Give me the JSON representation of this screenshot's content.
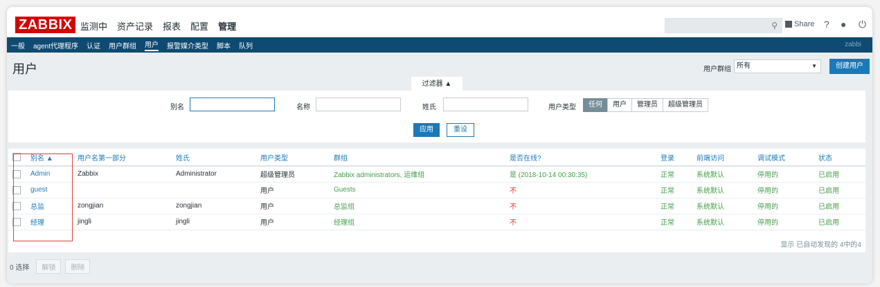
{
  "header": {
    "logo": "ZABBIX",
    "menu": [
      "监测中",
      "资产记录",
      "报表",
      "配置",
      "管理"
    ],
    "share": "Share",
    "help_icon": "?",
    "user_icon": "user",
    "power_icon": "power"
  },
  "subnav": {
    "items": [
      "一般",
      "agent代理程序",
      "认证",
      "用户群组",
      "用户",
      "报警媒介类型",
      "脚本",
      "队列"
    ],
    "right": "zabbi"
  },
  "page": {
    "title": "用户",
    "group_label": "用户群组",
    "group_value": "所有",
    "create_button": "创建用户"
  },
  "filter": {
    "tab": "过滤器 ▲",
    "alias_label": "别名",
    "alias_value": "",
    "name_label": "名称",
    "name_value": "",
    "surname_label": "姓氏",
    "surname_value": "",
    "type_label": "用户类型",
    "types": [
      "任何",
      "用户",
      "管理员",
      "超级管理员"
    ],
    "apply": "应用",
    "reset": "重设"
  },
  "table": {
    "headers": [
      "别名 ▲",
      "用户名第一部分",
      "姓氏",
      "用户类型",
      "群组",
      "是否在线?",
      "登录",
      "前端访问",
      "调试模式",
      "状态"
    ],
    "rows": [
      [
        "Admin",
        "Zabbix",
        "Administrator",
        "超级管理员",
        "Zabbix administrators, 运维组",
        "是 (2018-10-14 00:30:35)",
        "正常",
        "系统默认",
        "停用的",
        "已启用"
      ],
      [
        "guest",
        "",
        "",
        "用户",
        "Guests",
        "不",
        "正常",
        "系统默认",
        "停用的",
        "已启用"
      ],
      [
        "总监",
        "zongjian",
        "zongjian",
        "用户",
        "总监组",
        "不",
        "正常",
        "系统默认",
        "停用的",
        "已启用"
      ],
      [
        "经理",
        "jingli",
        "jingli",
        "用户",
        "经理组",
        "不",
        "正常",
        "系统默认",
        "停用的",
        "已启用"
      ]
    ],
    "summary": "显示 已自动发现的 4中的4"
  },
  "footer": {
    "selected": "0 选择",
    "unblock": "解锁",
    "delete": "删除"
  },
  "colors": {
    "logo_bg": "#d40000",
    "nav_bg": "#0e4a72",
    "link": "#1a79b8",
    "green": "#429e47",
    "red": "#e33734",
    "highlight": "#e23c3c"
  }
}
